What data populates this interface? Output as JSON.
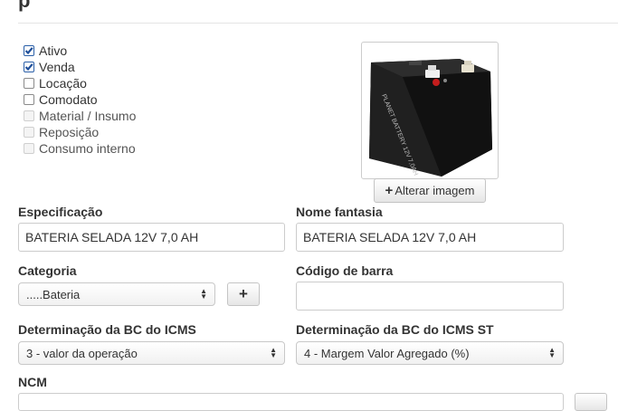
{
  "page": {
    "title_fragment": "p"
  },
  "checkboxes": [
    {
      "label": "Ativo",
      "checked": true,
      "enabled": true
    },
    {
      "label": "Venda",
      "checked": true,
      "enabled": true
    },
    {
      "label": "Locação",
      "checked": false,
      "enabled": true
    },
    {
      "label": "Comodato",
      "checked": false,
      "enabled": true
    },
    {
      "label": "Material / Insumo",
      "checked": false,
      "enabled": false
    },
    {
      "label": "Reposição",
      "checked": false,
      "enabled": false
    },
    {
      "label": "Consumo interno",
      "checked": false,
      "enabled": false
    }
  ],
  "image": {
    "change_button": "Alterar imagem",
    "battery_text": "PLANET BATTERY 12V 7,0AH"
  },
  "fields": {
    "especificacao": {
      "label": "Especificação",
      "value": "BATERIA SELADA 12V 7,0 AH"
    },
    "nome_fantasia": {
      "label": "Nome fantasia",
      "value": "BATERIA SELADA 12V 7,0 AH"
    },
    "categoria": {
      "label": "Categoria",
      "value": ".....Bateria"
    },
    "codigo_barra": {
      "label": "Código de barra",
      "value": ""
    },
    "bc_icms": {
      "label": "Determinação da BC do ICMS",
      "value": "3 - valor da operação"
    },
    "bc_icms_st": {
      "label": "Determinação da BC do ICMS ST",
      "value": "4 - Margem Valor Agregado (%)"
    },
    "ncm": {
      "label": "NCM"
    }
  },
  "colors": {
    "check_accent": "#2a5fa8",
    "border": "#cccccc"
  }
}
